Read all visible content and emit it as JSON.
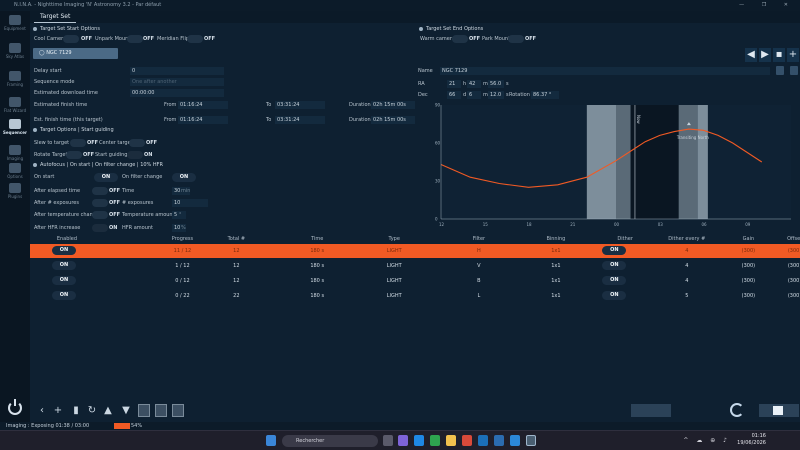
{
  "titlebar": {
    "text": "N.I.N.A. - Nighttime Imaging 'N' Astronomy 3.2 - Par défaut",
    "controls": "— ❐ ✕"
  },
  "sidebar": [
    {
      "label": "Equipment",
      "icon": "telescope-icon"
    },
    {
      "label": "Sky Atlas",
      "icon": "atlas-icon"
    },
    {
      "label": "Framing",
      "icon": "framing-icon"
    },
    {
      "label": "Flat Wizard",
      "icon": "flat-icon"
    },
    {
      "label": "Sequencer",
      "icon": "sequencer-icon",
      "selected": true
    },
    {
      "label": "Imaging",
      "icon": "imaging-icon"
    },
    {
      "label": "Options",
      "icon": "gear-icon"
    },
    {
      "label": "Plugins",
      "icon": "puzzle-icon"
    }
  ],
  "tab": "Target Set",
  "start_options": {
    "title": "Target Set Start Options",
    "cool_camera": "Cool Camera",
    "cool_state": "OFF",
    "unpark": "Unpark Mount",
    "unpark_state": "OFF",
    "meridian": "Meridian Flip",
    "meridian_state": "OFF"
  },
  "end_options": {
    "title": "Target Set End Options",
    "warm": "Warm camera",
    "warm_state": "OFF",
    "park": "Park Mount",
    "park_state": "OFF"
  },
  "target_button": "NGC 7129",
  "left_fields": {
    "delay_start": "Delay start",
    "delay_val": "0",
    "seq_mode": "Sequence mode",
    "seq_val": "One after another",
    "est_dl": "Estimated download time",
    "est_dl_val": "00:00:00",
    "est_finish": "Estimated finish time",
    "est_finish_this": "Est. finish time (this target)",
    "from": "From",
    "to": "To",
    "duration": "Duration",
    "from1": "01:16:24",
    "to1": "03:31:24",
    "dur1": "02h 15m 00s",
    "from2": "01:16:24",
    "to2": "03:31:24",
    "dur2": "02h 15m 00s"
  },
  "target_options": {
    "title": "Target Options | Start guiding",
    "slew": "Slew to target",
    "slew_state": "OFF",
    "center": "Center target",
    "center_state": "OFF",
    "rotate": "Rotate Target",
    "rotate_state": "OFF",
    "guide": "Start guiding",
    "guide_state": "ON"
  },
  "autofocus": {
    "title": "Autofocus | On start | On filter change | 10% HFR",
    "on_start": "On start",
    "on_start_state": "ON",
    "on_filter": "On filter change",
    "on_filter_state": "ON",
    "after_time": "After elapsed time",
    "after_time_state": "OFF",
    "time": "Time",
    "time_val": "30",
    "time_unit": "min",
    "after_exp": "After # exposures",
    "after_exp_state": "OFF",
    "exposures": "# exposures",
    "exp_val": "10",
    "after_temp": "After temperature change",
    "after_temp_state": "OFF",
    "temp_amount": "Temperature amount",
    "temp_val": "5",
    "temp_unit": "°",
    "after_hfr": "After HFR increase",
    "after_hfr_state": "ON",
    "hfr_amount": "HFR amount",
    "hfr_val": "10",
    "hfr_unit": "%"
  },
  "target": {
    "name_lbl": "Name",
    "name": "NGC 7129",
    "ra_lbl": "RA",
    "ra_h": "21",
    "ra_h_u": "h",
    "ra_m": "42",
    "ra_m_u": "m",
    "ra_s": "56.0",
    "ra_s_u": "s",
    "dec_lbl": "Dec",
    "dec_d": "66",
    "dec_d_u": "d",
    "dec_m": "6",
    "dec_m_u": "m",
    "dec_s": "12.0",
    "dec_s_u": "s",
    "rot_lbl": "Rotation",
    "rot": "86.37 °"
  },
  "chart_data": {
    "type": "line",
    "x_ticks": [
      "12",
      "15",
      "18",
      "21",
      "00",
      "03",
      "06",
      "09"
    ],
    "y_ticks": [
      "0",
      "30",
      "60",
      "90"
    ],
    "ylim": [
      0,
      90
    ],
    "now_label": "Now",
    "marker_label": "Transiting North",
    "values": [
      [
        12,
        43
      ],
      [
        14,
        33
      ],
      [
        16,
        28
      ],
      [
        18,
        25
      ],
      [
        20,
        27
      ],
      [
        22,
        33
      ],
      [
        0,
        46
      ],
      [
        2,
        61
      ],
      [
        3,
        66
      ],
      [
        4,
        69
      ],
      [
        5,
        71
      ],
      [
        6,
        70
      ],
      [
        7,
        66
      ],
      [
        8,
        60
      ],
      [
        10,
        45
      ]
    ]
  },
  "table": {
    "headers": [
      "Enabled",
      "Progress",
      "Total #",
      "Time",
      "Type",
      "Filter",
      "Binning",
      "Dither",
      "Dither every #",
      "Gain",
      "Offset"
    ],
    "rows": [
      [
        "ON",
        "11 / 12",
        "12",
        "180 s",
        "LIGHT",
        "H",
        "1x1",
        "ON",
        "4",
        "(300)",
        "(300)"
      ],
      [
        "ON",
        "1 / 12",
        "12",
        "180 s",
        "LIGHT",
        "V",
        "1x1",
        "ON",
        "4",
        "(300)",
        "(300)"
      ],
      [
        "ON",
        "0 / 12",
        "12",
        "180 s",
        "LIGHT",
        "B",
        "1x1",
        "ON",
        "4",
        "(300)",
        "(300)"
      ],
      [
        "ON",
        "0 / 22",
        "22",
        "180 s",
        "LIGHT",
        "L",
        "1x1",
        "ON",
        "5",
        "(300)",
        "(300)"
      ]
    ]
  },
  "status": {
    "text": "Imaging :   Exposing 01:38 / 03:00",
    "percent": "54%",
    "progress": 0.54
  },
  "taskbar": {
    "search": "Rechercher",
    "time": "01:16",
    "date": "19/06/2026",
    "tray": "^ ☁ ⊕ ♪"
  }
}
